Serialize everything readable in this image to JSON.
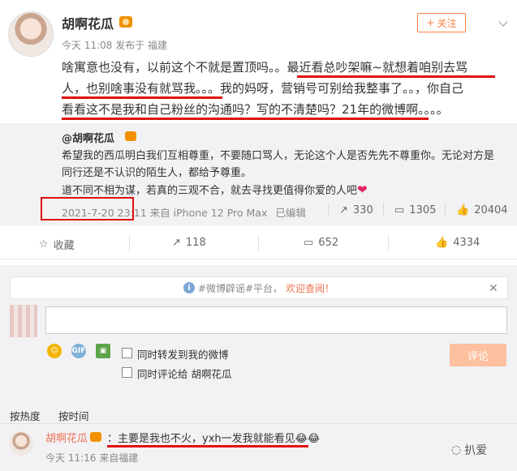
{
  "post": {
    "username": "胡啊花瓜",
    "meta": "今天 11:08 发布于 福建",
    "follow_label": "关注",
    "text_line1": "啥寓意也没有，以前这个不就是置顶吗。。最近看总吵架嘛~就想着咱别去骂",
    "text_line2": "人，也别啥事没有就骂我。。。我的妈呀，营销号可别给我整事了。。，你自己",
    "text_line3": "看看这不是我和自己粉丝的沟通吗？写的不清楚吗？21年的微博啊。。。。"
  },
  "quoted": {
    "username": "@胡啊花瓜",
    "text_line1": "希望我的西瓜明白我们互相尊重，不要随口骂人，无论这个人是否先先不尊重你。无论对方是",
    "text_line2": "同行还是不认识的陌生人，都给予尊重。",
    "text_line3": "道不同不相为谋，若真的三观不合，就去寻找更值得你爱的人吧",
    "date": "2021-7-20 23:11",
    "source": "来自 iPhone 12 Pro Max",
    "edited": "已编辑",
    "reposts": "330",
    "comments": "1305",
    "likes": "20404"
  },
  "actions": {
    "favorite": "收藏",
    "reposts": "118",
    "comments": "652",
    "likes": "4334"
  },
  "comment_box": {
    "notice_prefix": "#微博辟谣#平台，",
    "notice_link": "欢迎查阅！",
    "repost_option": "同时转发到我的微博",
    "comment_option": "同时评论给 胡啊花瓜",
    "submit_label": "评论"
  },
  "sort": {
    "by_hot": "按热度",
    "by_time": "按时间"
  },
  "reply": {
    "username": "胡啊花瓜",
    "text": "：主要是我也不火，yxh一发我就能看见😂😂",
    "meta": "今天 11:16 来自福建"
  },
  "watermark": "扒爱",
  "colors": {
    "accent": "#ff8140",
    "highlight_red": "#e01010",
    "link": "#eb7350"
  }
}
